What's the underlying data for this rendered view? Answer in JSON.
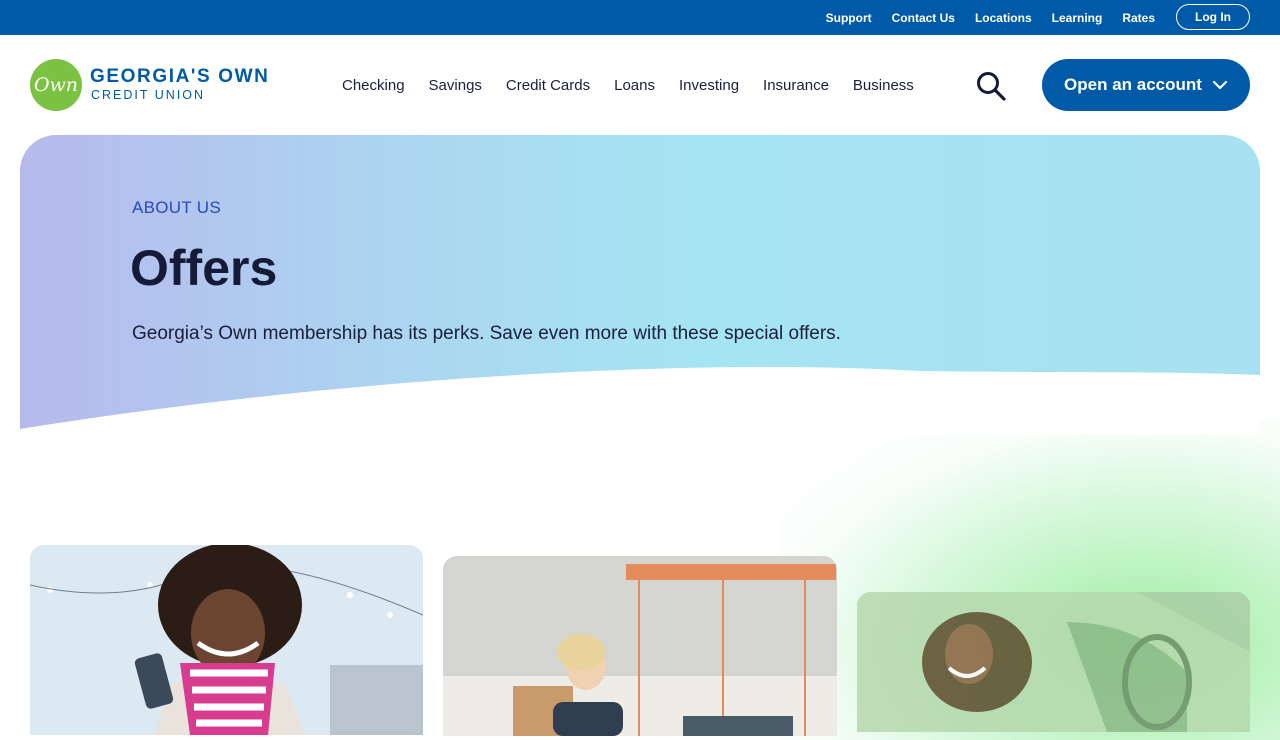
{
  "utility": {
    "links": [
      "Support",
      "Contact Us",
      "Locations",
      "Learning",
      "Rates"
    ],
    "login_label": "Log In"
  },
  "logo": {
    "mark": "Own",
    "name": "GEORGIA'S OWN",
    "sub": "CREDIT UNION"
  },
  "nav": {
    "items": [
      "Checking",
      "Savings",
      "Credit Cards",
      "Loans",
      "Investing",
      "Insurance",
      "Business"
    ],
    "search_icon": "search-icon",
    "open_account_label": "Open an account",
    "open_account_icon": "chevron-down-icon"
  },
  "hero": {
    "eyebrow": "ABOUT US",
    "title": "Offers",
    "description": "Georgia’s Own membership has its perks. Save even more with these special offers."
  },
  "colors": {
    "brand_blue": "#005aa7",
    "brand_green": "#7cc242",
    "eyebrow_blue": "#2a4ab8"
  }
}
